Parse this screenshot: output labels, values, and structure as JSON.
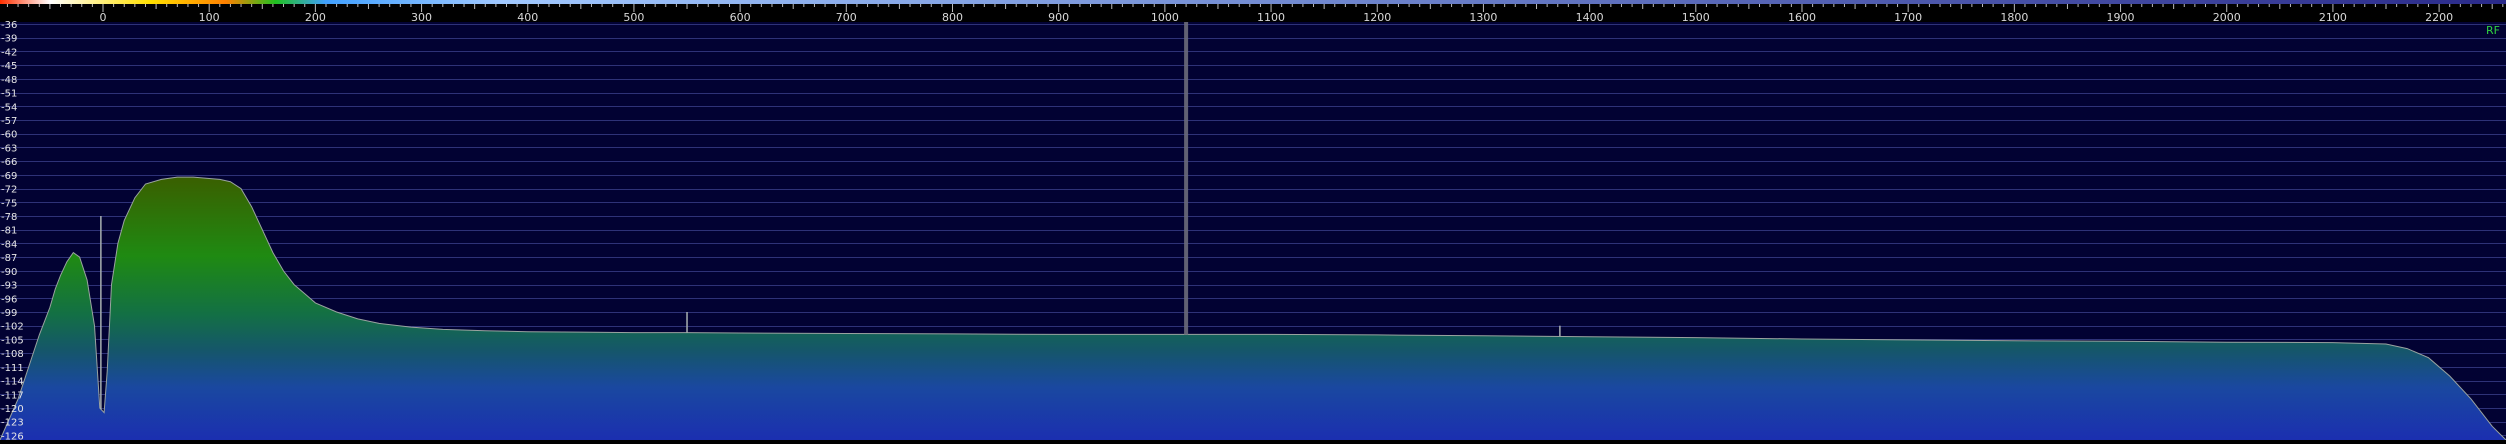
{
  "chart_data": {
    "type": "area",
    "x_ticks": [
      0,
      100,
      200,
      300,
      400,
      500,
      600,
      700,
      800,
      900,
      1000,
      1100,
      1200,
      1300,
      1400,
      1500,
      1600,
      1700,
      1800,
      1900,
      2000,
      2100,
      2200
    ],
    "xlim": [
      -97,
      2263
    ],
    "y_ticks": [
      -36,
      -39,
      -42,
      -45,
      -48,
      -51,
      -54,
      -57,
      -60,
      -63,
      -66,
      -69,
      -72,
      -75,
      -78,
      -81,
      -84,
      -87,
      -90,
      -93,
      -96,
      -99,
      -102,
      -105,
      -108,
      -111,
      -114,
      -117,
      -120,
      -123,
      -126
    ],
    "ylim": [
      -127,
      -36
    ],
    "channel_label": "RF",
    "marker_x": 1020,
    "series": [
      {
        "x": [
          -97,
          -80,
          -70,
          -60,
          -50,
          -45,
          -40,
          -34,
          -28,
          -22,
          -15,
          -8,
          -3,
          1,
          4,
          8,
          14,
          20,
          30,
          40,
          55,
          70,
          85,
          100,
          110,
          120,
          130,
          140,
          150,
          160,
          170,
          180,
          190,
          200,
          220,
          240,
          260,
          290,
          320,
          360,
          400,
          450,
          500,
          550,
          600,
          700,
          800,
          900,
          1000,
          1100,
          1200,
          1300,
          1400,
          1500,
          1600,
          1700,
          1800,
          1900,
          2000,
          2100,
          2150,
          2170,
          2190,
          2210,
          2230,
          2250,
          2263
        ],
        "values": [
          -127,
          -118,
          -111,
          -104,
          -98,
          -94,
          -91,
          -88,
          -86,
          -87,
          -92,
          -102,
          -120,
          -121,
          -112,
          -93,
          -84,
          -79,
          -74,
          -71,
          -70,
          -69.5,
          -69.5,
          -69.8,
          -70,
          -70.5,
          -72,
          -76,
          -81,
          -86,
          -90,
          -93,
          -95,
          -97,
          -99,
          -100.5,
          -101.5,
          -102.3,
          -102.8,
          -103.1,
          -103.3,
          -103.4,
          -103.5,
          -103.5,
          -103.6,
          -103.7,
          -103.8,
          -103.9,
          -103.9,
          -103.9,
          -104,
          -104.2,
          -104.4,
          -104.6,
          -104.9,
          -105.1,
          -105.3,
          -105.4,
          -105.6,
          -105.7,
          -106,
          -107,
          -109,
          -113,
          -118,
          -124,
          -127
        ]
      }
    ],
    "spikes": [
      {
        "x": -2,
        "value": -78
      },
      {
        "x": 550,
        "value": -99
      },
      {
        "x": 1372,
        "value": -102
      }
    ]
  }
}
